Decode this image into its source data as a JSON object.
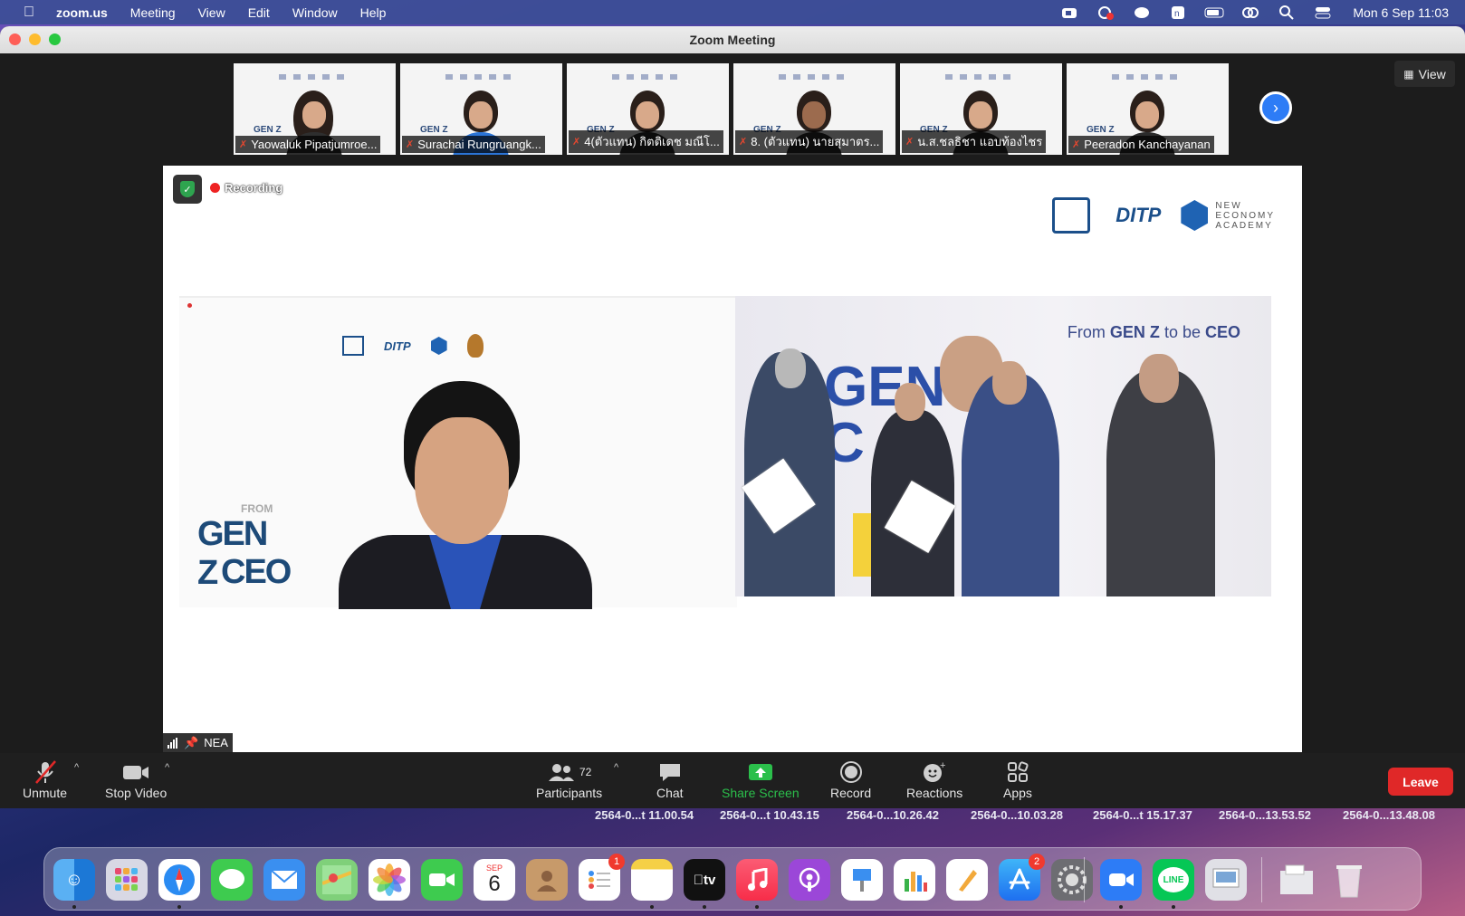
{
  "menubar": {
    "app_name": "zoom.us",
    "items": [
      "Meeting",
      "View",
      "Edit",
      "Window",
      "Help"
    ],
    "clock": "Mon 6 Sep  11:03"
  },
  "window": {
    "title": "Zoom Meeting"
  },
  "participants_strip": [
    {
      "name": "Yaowaluk Pipatjumroe..."
    },
    {
      "name": "Surachai Rungruangk..."
    },
    {
      "name": "4(ตัวแทน) กิตติเดช มณีโ..."
    },
    {
      "name": "8. (ตัวแทน) นายสุมาตร..."
    },
    {
      "name": "น.ส.ชลธิชา แอบท้องไชร"
    },
    {
      "name": "Peeradon Kanchayanan"
    }
  ],
  "view_button": "View",
  "shared_screen": {
    "recording_label": "Recording",
    "logo_ditp": "DITP",
    "logo_nea": "NEW\nECONOMY\nACADEMY",
    "left_panel": {
      "from": "FROM",
      "genz": "GEN Z",
      "ceo": "CEO"
    },
    "right_panel": {
      "title_prefix": "From ",
      "title_bold": "GEN Z",
      "title_suffix": " to be ",
      "title_end": "CEO"
    }
  },
  "speaker_label": "NEA",
  "toolbar": {
    "unmute": "Unmute",
    "stop_video": "Stop Video",
    "participants_count": "72",
    "participants": "Participants",
    "chat": "Chat",
    "share_screen": "Share Screen",
    "record": "Record",
    "reactions": "Reactions",
    "apps": "Apps",
    "leave": "Leave"
  },
  "desktop_files": [
    "2564-0...t 11.00.54",
    "2564-0...t 10.43.15",
    "2564-0...10.26.42",
    "2564-0...10.03.28",
    "2564-0...t 15.17.37",
    "2564-0...13.53.52",
    "2564-0...13.48.08"
  ],
  "dock": {
    "calendar_month": "SEP",
    "calendar_day": "6",
    "reminders_badge": "1",
    "appstore_badge": "2",
    "line_label": "LINE",
    "tv_label": "tv"
  },
  "colors": {
    "accent_green": "#2bbf4b",
    "leave_red": "#e02828",
    "zoom_blue": "#2d7cf6"
  }
}
